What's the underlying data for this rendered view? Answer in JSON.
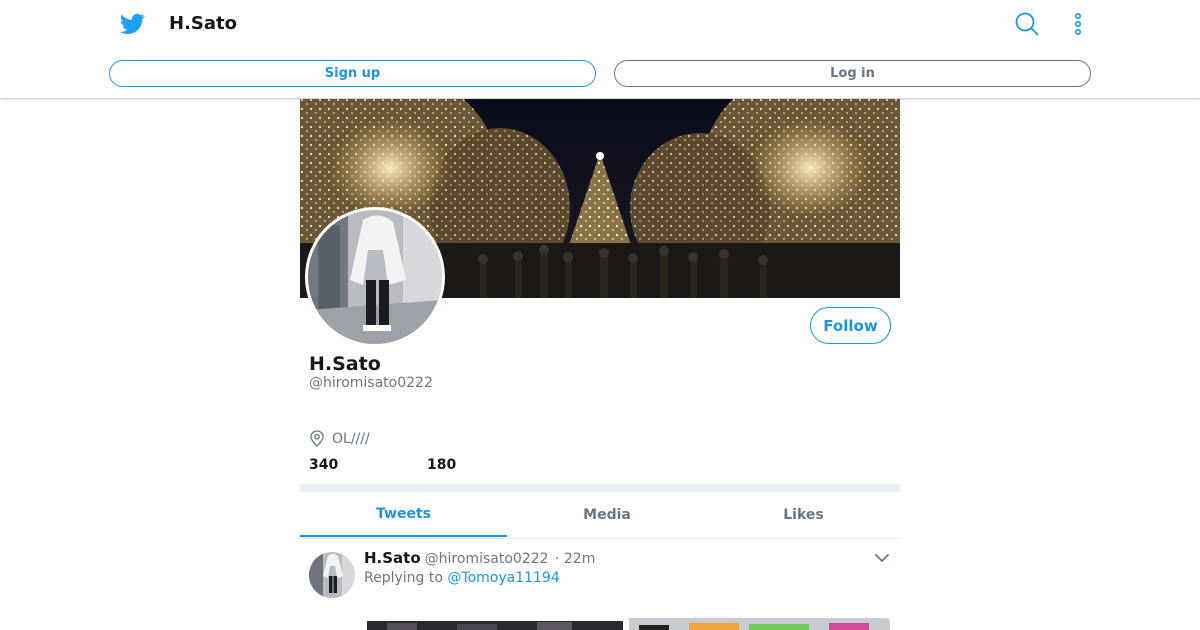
{
  "header": {
    "title": "H.Sato",
    "signup_label": "Sign up",
    "login_label": "Log in",
    "icons": [
      "twitter-bird-icon",
      "search-icon",
      "more-icon"
    ]
  },
  "profile": {
    "name": "H.Sato",
    "handle": "@hiromisato0222",
    "location": "OL////",
    "stat_1": "340",
    "stat_2": "180",
    "follow_label": "Follow"
  },
  "tabs": [
    {
      "label": "Tweets",
      "active": true
    },
    {
      "label": "Media",
      "active": false
    },
    {
      "label": "Likes",
      "active": false
    }
  ],
  "tweet": {
    "name": "H.Sato",
    "handle": "@hiromisato0222",
    "time": "· 22m",
    "replying_prefix": "Replying to",
    "replying_to": "@Tomoya11194"
  },
  "colors": {
    "accent": "#1b95e0",
    "secondary_text": "#657786",
    "primary_text": "#14171a",
    "divider": "#e6ecf0"
  }
}
